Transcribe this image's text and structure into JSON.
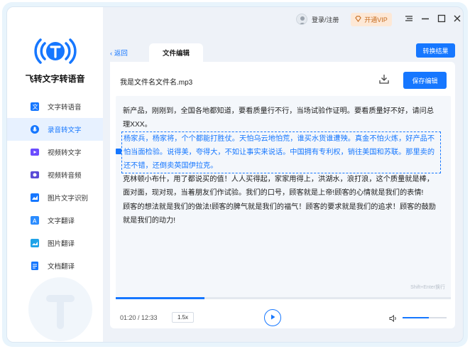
{
  "app": {
    "title": "飞转文字转语音"
  },
  "topbar": {
    "login_label": "登录/注册",
    "vip_label": "开通VIP"
  },
  "sidebar": {
    "items": [
      {
        "label": "文字转语音",
        "icon": "text-to-speech-icon",
        "active": false
      },
      {
        "label": "录音转文字",
        "icon": "recording-to-text-icon",
        "active": true
      },
      {
        "label": "视频转文字",
        "icon": "video-to-text-icon",
        "active": false
      },
      {
        "label": "视频转音频",
        "icon": "video-to-audio-icon",
        "active": false
      },
      {
        "label": "图片文字识别",
        "icon": "image-ocr-icon",
        "active": false
      },
      {
        "label": "文字翻译",
        "icon": "text-translate-icon",
        "active": false
      },
      {
        "label": "图片翻译",
        "icon": "image-translate-icon",
        "active": false
      },
      {
        "label": "文档翻译",
        "icon": "document-translate-icon",
        "active": false
      }
    ]
  },
  "editor": {
    "back_label": "返回",
    "tab_label": "文件编辑",
    "convert_label": "转换结果",
    "file_name": "我是文件名文件名.mp3",
    "save_label": "保存编辑",
    "paragraphs": [
      "新产品，刚刚到，全国各地都知道，要看质量行不行，当场试验作证明。要看质量好不好，请问总理XXX。",
      "杨家兵，杨家将，个个都能打胜仗。天怕乌云地怕荒，谁买水货谁遭殃。真金不怕火炼，好产品不怕当面检验。说得美，夸得大，不如让事实来说话。中国拥有专利权，销往美国和苏联。那里卖的还不错，还倒卖英国伊拉克。",
      "克林顿小布什，用了都说买的值！人人买得起，家家用得上，洪湖水，浪打浪，这个质量就是棒，面对面，现对现，当着朋友们作试验。我们的口号，顾客就是上帝!顾客的心情就是我们的表情!",
      "顾客的想法就是我们的做法!顾客的脾气就是我们的福气！顾客的要求就是我们的追求！顾客的鼓励就是我们的动力!"
    ],
    "highlighted_paragraph_index": 1,
    "hint": "Shift+Enter换行"
  },
  "player": {
    "current_time": "01:20",
    "total_time": "12:33",
    "time_display": "01:20 / 12:33",
    "speed": "1.5x",
    "progress_fraction": 0.265,
    "volume_fraction": 0.6
  },
  "colors": {
    "accent": "#1677ff",
    "vip_bg": "#fde8d6",
    "vip_text": "#c66b1e"
  }
}
